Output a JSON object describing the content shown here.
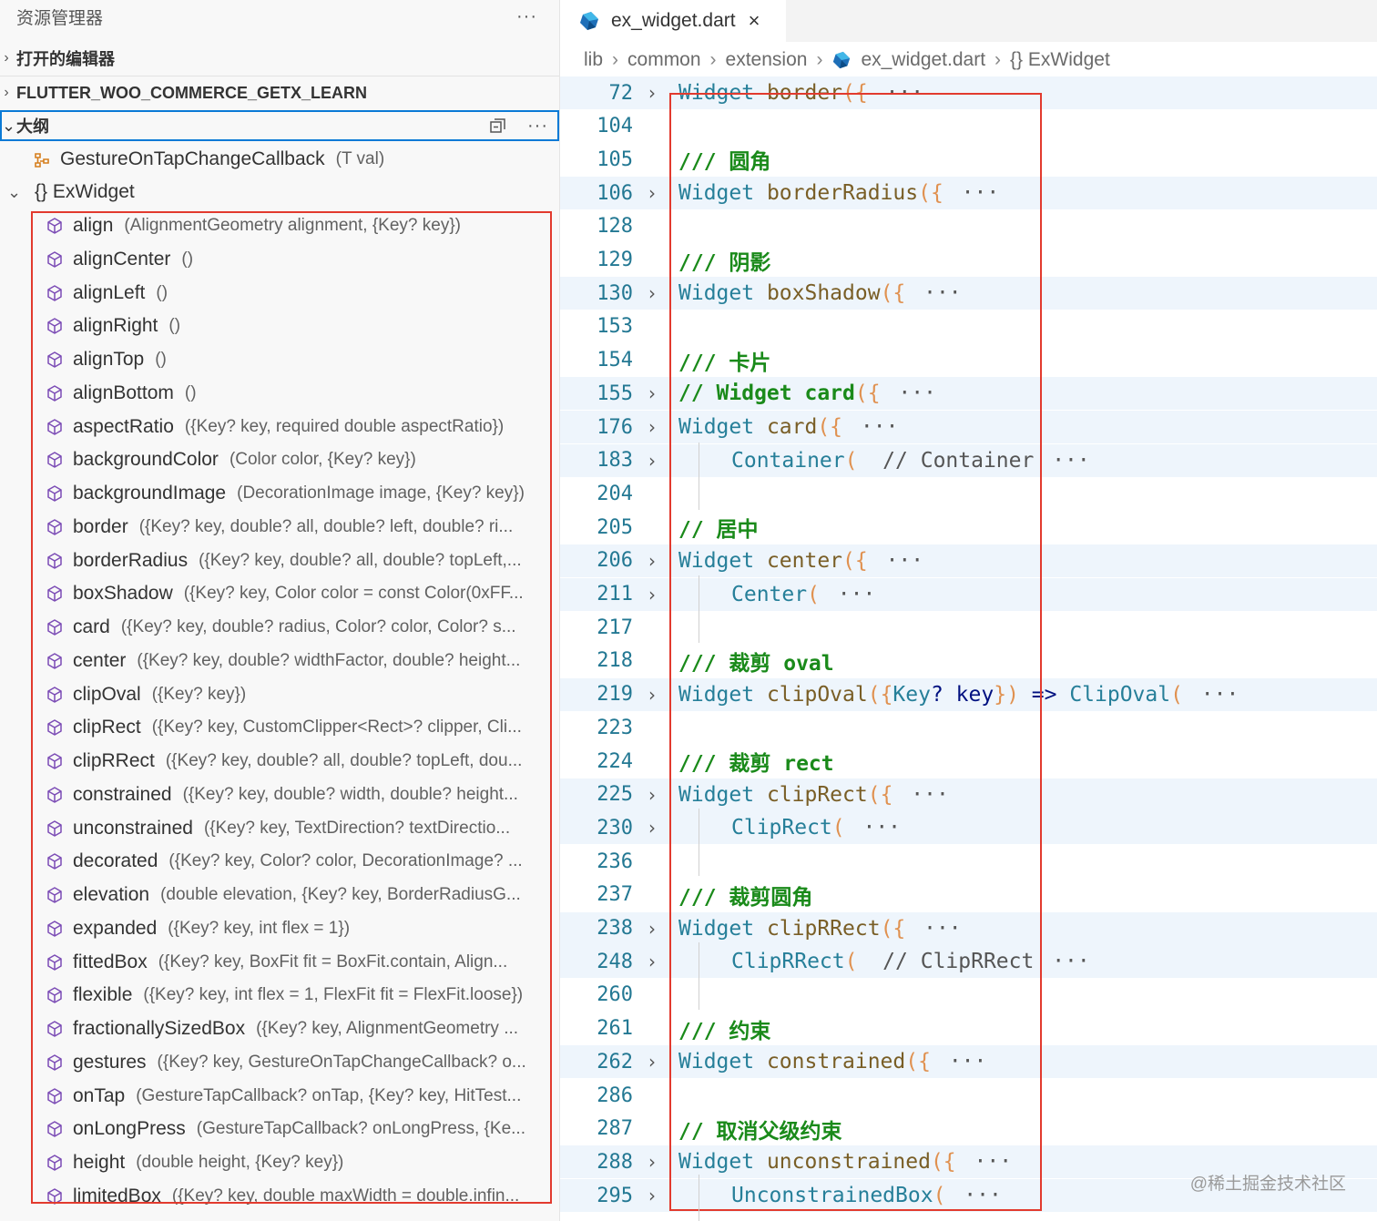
{
  "explorer": {
    "title": "资源管理器",
    "more": "···",
    "sections": {
      "open_editors": "打开的编辑器",
      "project": "FLUTTER_WOO_COMMERCE_GETX_LEARN",
      "outline": "大纲"
    },
    "outline_more": "···",
    "top_items": [
      {
        "name": "GestureOnTapChangeCallback",
        "sig": "(T val)",
        "icon": "type-parameter-icon"
      },
      {
        "name": "{} ExWidget",
        "sig": "",
        "icon": "chevron-down-icon"
      }
    ],
    "methods": [
      {
        "name": "align",
        "sig": "(AlignmentGeometry alignment, {Key? key})"
      },
      {
        "name": "alignCenter",
        "sig": "()"
      },
      {
        "name": "alignLeft",
        "sig": "()"
      },
      {
        "name": "alignRight",
        "sig": "()"
      },
      {
        "name": "alignTop",
        "sig": "()"
      },
      {
        "name": "alignBottom",
        "sig": "()"
      },
      {
        "name": "aspectRatio",
        "sig": "({Key? key, required double aspectRatio})"
      },
      {
        "name": "backgroundColor",
        "sig": "(Color color, {Key? key})"
      },
      {
        "name": "backgroundImage",
        "sig": "(DecorationImage image, {Key? key})"
      },
      {
        "name": "border",
        "sig": "({Key? key, double? all, double? left, double? ri..."
      },
      {
        "name": "borderRadius",
        "sig": "({Key? key, double? all, double? topLeft,..."
      },
      {
        "name": "boxShadow",
        "sig": "({Key? key, Color color = const Color(0xFF..."
      },
      {
        "name": "card",
        "sig": "({Key? key, double? radius, Color? color, Color? s..."
      },
      {
        "name": "center",
        "sig": "({Key? key, double? widthFactor, double? height..."
      },
      {
        "name": "clipOval",
        "sig": "({Key? key})"
      },
      {
        "name": "clipRect",
        "sig": "({Key? key, CustomClipper<Rect>? clipper, Cli..."
      },
      {
        "name": "clipRRect",
        "sig": "({Key? key, double? all, double? topLeft, dou..."
      },
      {
        "name": "constrained",
        "sig": "({Key? key, double? width, double? height..."
      },
      {
        "name": "unconstrained",
        "sig": "({Key? key, TextDirection? textDirectio..."
      },
      {
        "name": "decorated",
        "sig": "({Key? key, Color? color, DecorationImage? ..."
      },
      {
        "name": "elevation",
        "sig": "(double elevation, {Key? key, BorderRadiusG..."
      },
      {
        "name": "expanded",
        "sig": "({Key? key, int flex = 1})"
      },
      {
        "name": "fittedBox",
        "sig": "({Key? key, BoxFit fit = BoxFit.contain, Align..."
      },
      {
        "name": "flexible",
        "sig": "({Key? key, int flex = 1, FlexFit fit = FlexFit.loose})"
      },
      {
        "name": "fractionallySizedBox",
        "sig": "({Key? key, AlignmentGeometry ..."
      },
      {
        "name": "gestures",
        "sig": "({Key? key, GestureOnTapChangeCallback? o..."
      },
      {
        "name": "onTap",
        "sig": "(GestureTapCallback? onTap, {Key? key, HitTest..."
      },
      {
        "name": "onLongPress",
        "sig": "(GestureTapCallback? onLongPress, {Ke..."
      },
      {
        "name": "height",
        "sig": "(double height, {Key? key})"
      },
      {
        "name": "limitedBox",
        "sig": "({Key? key, double maxWidth = double.infin..."
      }
    ]
  },
  "editor": {
    "tab_title": "ex_widget.dart",
    "tab_close": "×",
    "breadcrumbs": [
      "lib",
      "common",
      "extension",
      "ex_widget.dart",
      "{} ExWidget"
    ],
    "lines": [
      {
        "n": "72",
        "fold": true,
        "parts": [
          [
            "kw",
            "Widget "
          ],
          [
            "fn",
            "border"
          ],
          [
            "pr",
            "({"
          ],
          [
            "ellip",
            " ···"
          ]
        ]
      },
      {
        "n": "104",
        "fold": false,
        "parts": []
      },
      {
        "n": "105",
        "fold": false,
        "parts": [
          [
            "cm",
            "/// 圆角"
          ]
        ]
      },
      {
        "n": "106",
        "fold": true,
        "parts": [
          [
            "kw",
            "Widget "
          ],
          [
            "fn",
            "borderRadius"
          ],
          [
            "pr",
            "({"
          ],
          [
            "ellip",
            " ···"
          ]
        ]
      },
      {
        "n": "128",
        "fold": false,
        "parts": []
      },
      {
        "n": "129",
        "fold": false,
        "parts": [
          [
            "cm",
            "/// 阴影"
          ]
        ]
      },
      {
        "n": "130",
        "fold": true,
        "parts": [
          [
            "kw",
            "Widget "
          ],
          [
            "fn",
            "boxShadow"
          ],
          [
            "pr",
            "({"
          ],
          [
            "ellip",
            " ···"
          ]
        ]
      },
      {
        "n": "153",
        "fold": false,
        "parts": []
      },
      {
        "n": "154",
        "fold": false,
        "parts": [
          [
            "cm",
            "/// 卡片"
          ]
        ]
      },
      {
        "n": "155",
        "fold": true,
        "parts": [
          [
            "cm",
            "// Widget card"
          ],
          [
            "pr",
            "({"
          ],
          [
            "ellip",
            " ···"
          ]
        ]
      },
      {
        "n": "176",
        "fold": true,
        "parts": [
          [
            "kw",
            "Widget "
          ],
          [
            "fn",
            "card"
          ],
          [
            "pr",
            "({"
          ],
          [
            "ellip",
            " ···"
          ]
        ]
      },
      {
        "n": "183",
        "fold": true,
        "indent": true,
        "parts": [
          [
            "kw",
            "Container"
          ],
          [
            "pr",
            "( "
          ],
          [
            "dim",
            " // Container"
          ],
          [
            "ellip",
            " ···"
          ]
        ]
      },
      {
        "n": "204",
        "fold": false,
        "parts": []
      },
      {
        "n": "205",
        "fold": false,
        "parts": [
          [
            "cm",
            "// 居中"
          ]
        ]
      },
      {
        "n": "206",
        "fold": true,
        "parts": [
          [
            "kw",
            "Widget "
          ],
          [
            "fn",
            "center"
          ],
          [
            "pr",
            "({"
          ],
          [
            "ellip",
            " ···"
          ]
        ]
      },
      {
        "n": "211",
        "fold": true,
        "indent": true,
        "parts": [
          [
            "kw",
            "Center"
          ],
          [
            "pr",
            "("
          ],
          [
            "ellip",
            " ···"
          ]
        ]
      },
      {
        "n": "217",
        "fold": false,
        "parts": []
      },
      {
        "n": "218",
        "fold": false,
        "parts": [
          [
            "cm",
            "/// 裁剪 oval"
          ]
        ]
      },
      {
        "n": "219",
        "fold": true,
        "parts": [
          [
            "kw",
            "Widget "
          ],
          [
            "fn",
            "clipOval"
          ],
          [
            "pr",
            "({"
          ],
          [
            "kw",
            "Key"
          ],
          [
            "var",
            "? key"
          ],
          [
            "pr",
            "}) "
          ],
          [
            "var",
            "=> "
          ],
          [
            "kw",
            "ClipOval"
          ],
          [
            "pr",
            "("
          ],
          [
            "ellip",
            " ···"
          ]
        ]
      },
      {
        "n": "223",
        "fold": false,
        "parts": []
      },
      {
        "n": "224",
        "fold": false,
        "parts": [
          [
            "cm",
            "/// 裁剪 rect"
          ]
        ]
      },
      {
        "n": "225",
        "fold": true,
        "parts": [
          [
            "kw",
            "Widget "
          ],
          [
            "fn",
            "clipRect"
          ],
          [
            "pr",
            "({"
          ],
          [
            "ellip",
            " ···"
          ]
        ]
      },
      {
        "n": "230",
        "fold": true,
        "indent": true,
        "parts": [
          [
            "kw",
            "ClipRect"
          ],
          [
            "pr",
            "("
          ],
          [
            "ellip",
            " ···"
          ]
        ]
      },
      {
        "n": "236",
        "fold": false,
        "parts": []
      },
      {
        "n": "237",
        "fold": false,
        "parts": [
          [
            "cm",
            "/// 裁剪圆角"
          ]
        ]
      },
      {
        "n": "238",
        "fold": true,
        "parts": [
          [
            "kw",
            "Widget "
          ],
          [
            "fn",
            "clipRRect"
          ],
          [
            "pr",
            "({"
          ],
          [
            "ellip",
            " ···"
          ]
        ]
      },
      {
        "n": "248",
        "fold": true,
        "indent": true,
        "parts": [
          [
            "kw",
            "ClipRRect"
          ],
          [
            "pr",
            "( "
          ],
          [
            "dim",
            " // ClipRRect"
          ],
          [
            "ellip",
            " ···"
          ]
        ]
      },
      {
        "n": "260",
        "fold": false,
        "parts": []
      },
      {
        "n": "261",
        "fold": false,
        "parts": [
          [
            "cm",
            "/// 约束"
          ]
        ]
      },
      {
        "n": "262",
        "fold": true,
        "parts": [
          [
            "kw",
            "Widget "
          ],
          [
            "fn",
            "constrained"
          ],
          [
            "pr",
            "({"
          ],
          [
            "ellip",
            " ···"
          ]
        ]
      },
      {
        "n": "286",
        "fold": false,
        "parts": []
      },
      {
        "n": "287",
        "fold": false,
        "parts": [
          [
            "cm",
            "// 取消父级约束"
          ]
        ]
      },
      {
        "n": "288",
        "fold": true,
        "parts": [
          [
            "kw",
            "Widget "
          ],
          [
            "fn",
            "unconstrained"
          ],
          [
            "pr",
            "({"
          ],
          [
            "ellip",
            " ···"
          ]
        ]
      },
      {
        "n": "295",
        "fold": true,
        "indent": true,
        "parts": [
          [
            "kw",
            "UnconstrainedBox"
          ],
          [
            "pr",
            "("
          ],
          [
            "ellip",
            " ···"
          ]
        ]
      }
    ]
  },
  "watermark": "@稀土掘金技术社区",
  "colors": {
    "highlight_box": "#e23a2e",
    "focus_border": "#0a7ad6",
    "fold_bg": "#eef5fc"
  }
}
